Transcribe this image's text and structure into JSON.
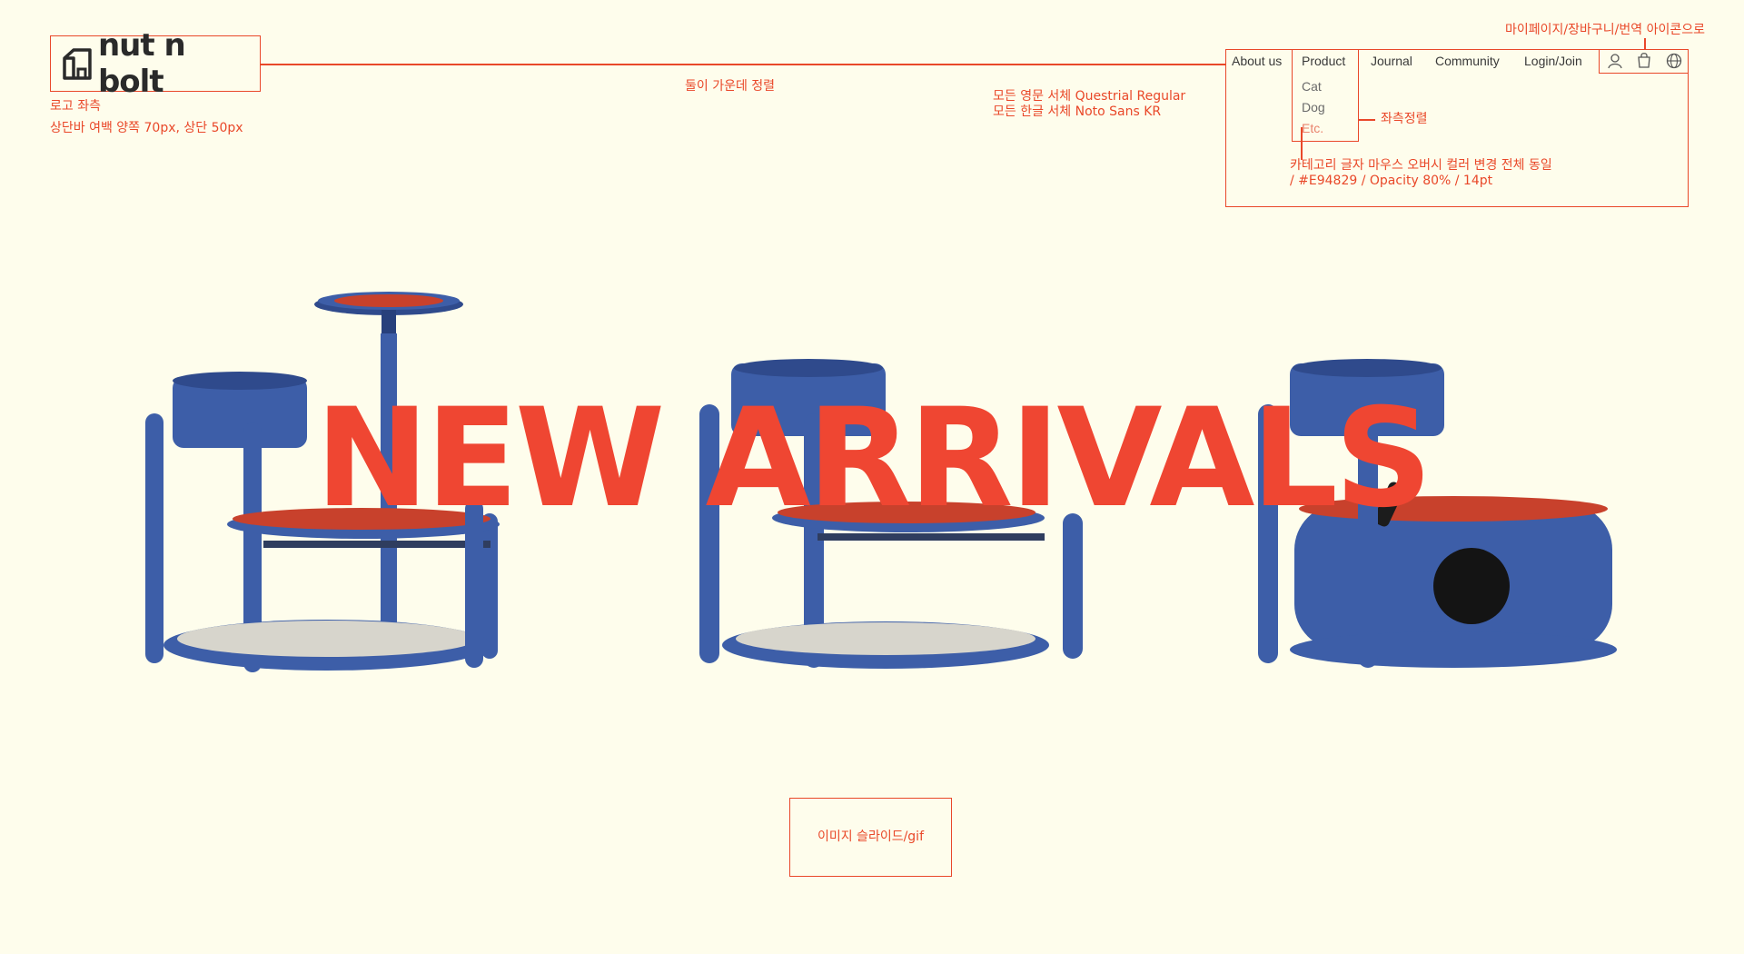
{
  "brand": {
    "name": "nut n bolt"
  },
  "nav": {
    "items": [
      {
        "label": "About us"
      },
      {
        "label": "Product"
      },
      {
        "label": "Journal"
      },
      {
        "label": "Community"
      },
      {
        "label": "Login/Join"
      }
    ],
    "product_submenu": [
      {
        "label": "Cat"
      },
      {
        "label": "Dog"
      },
      {
        "label": "Etc."
      }
    ],
    "icons": [
      "user-icon",
      "shopping-bag-icon",
      "globe-icon"
    ]
  },
  "hero": {
    "title": "NEW ARRIVALS"
  },
  "annotations": {
    "logo_left": "로고 좌측",
    "header_margin": "상단바 여백 양쪽 70px, 상단 50px",
    "center_align": "둘이 가운데 정렬",
    "font_en": "모든 영문 서체 Questrial Regular",
    "font_kr": "모든 한글 서체 Noto Sans KR",
    "left_align": "좌측정렬",
    "hover_line1": "카테고리 글자 마우스 오버시 컬러 변경 전체 동일",
    "hover_line2": "/ #E94829 / Opacity 80% / 14pt",
    "icons_note": "마이페이지/장바구니/번역 아이콘으로",
    "slide_note": "이미지 슬라이드/gif"
  },
  "colors": {
    "background": "#fefdec",
    "accent": "#e94829",
    "furniture_blue": "#3d5ea8",
    "cushion_red": "#c8412c"
  }
}
